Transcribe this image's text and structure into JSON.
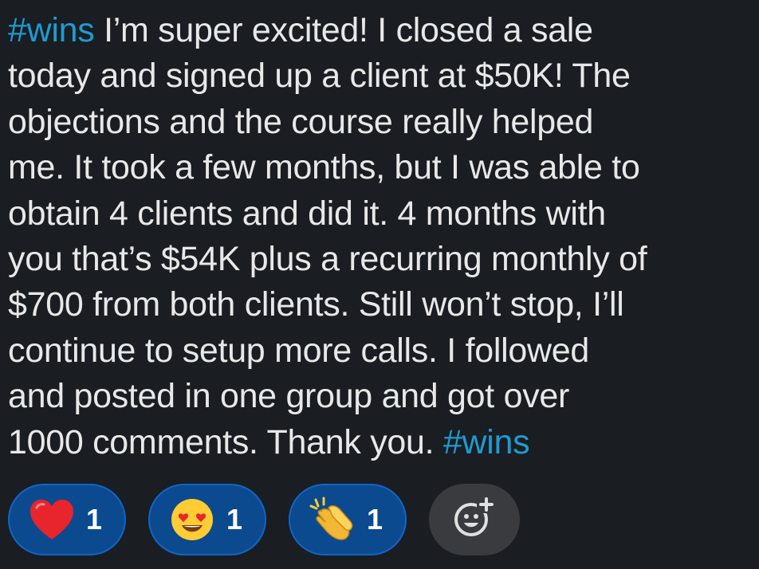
{
  "message": {
    "lines": [
      {
        "hashtag": "#wins",
        "text": " I’m super excited! I closed a sale"
      },
      {
        "text": "today and signed up a client at $50K! The"
      },
      {
        "text": "objections and the course really helped"
      },
      {
        "text": "me. It took a few months, but I was able to"
      },
      {
        "text": "obtain 4 clients and did it.  4 months with"
      },
      {
        "text": "you that’s $54K plus a recurring monthly of"
      },
      {
        "text": "$700 from both clients. Still won’t stop, I’ll"
      },
      {
        "text": "continue to setup more calls. I followed"
      },
      {
        "text": "and posted in one group and got over"
      },
      {
        "text": "1000 comments. Thank you.  ",
        "hashtag_end": "#wins"
      }
    ]
  },
  "reactions": [
    {
      "icon": "heart-icon",
      "count": "1"
    },
    {
      "icon": "heart-eyes-face-icon",
      "count": "1"
    },
    {
      "icon": "clapping-hands-icon",
      "count": "1"
    }
  ],
  "add_reaction": {
    "icon": "add-reaction-icon"
  },
  "colors": {
    "background": "#1a1d21",
    "text": "#e8e8e8",
    "hashtag": "#1d9bd1",
    "reaction_bg": "#0b4a8f",
    "reaction_border": "#1264c7",
    "add_reaction_bg": "#3a3b3e"
  }
}
